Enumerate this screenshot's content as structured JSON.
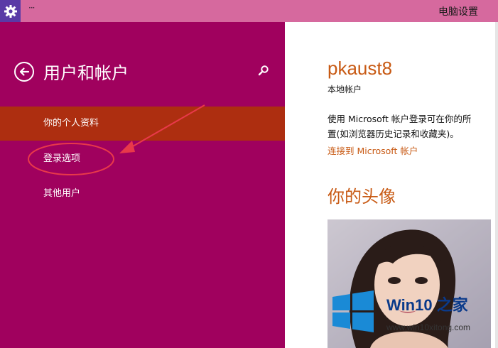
{
  "titlebar": {
    "title": "电脑设置",
    "menu_dots": "···"
  },
  "sidebar": {
    "heading": "用户和帐户",
    "items": [
      {
        "label": "你的个人资料",
        "active": true
      },
      {
        "label": "登录选项",
        "active": false
      },
      {
        "label": "其他用户",
        "active": false
      }
    ]
  },
  "profile": {
    "username": "pkaust8",
    "account_type": "本地帐户",
    "description": "使用 Microsoft 帐户登录可在你的所\n置(如浏览器历史记录和收藏夹)。",
    "link": "连接到 Microsoft 帐户",
    "avatar_heading": "你的头像"
  },
  "watermark": {
    "brand": "Win10 之家",
    "site": "www.win10xitong.com"
  },
  "colors": {
    "titlebar": "#d6699e",
    "sidebar_bg": "#a0015e",
    "active_item": "#ad2e10",
    "accent_text": "#c85a14",
    "annotation": "#e8394a"
  }
}
